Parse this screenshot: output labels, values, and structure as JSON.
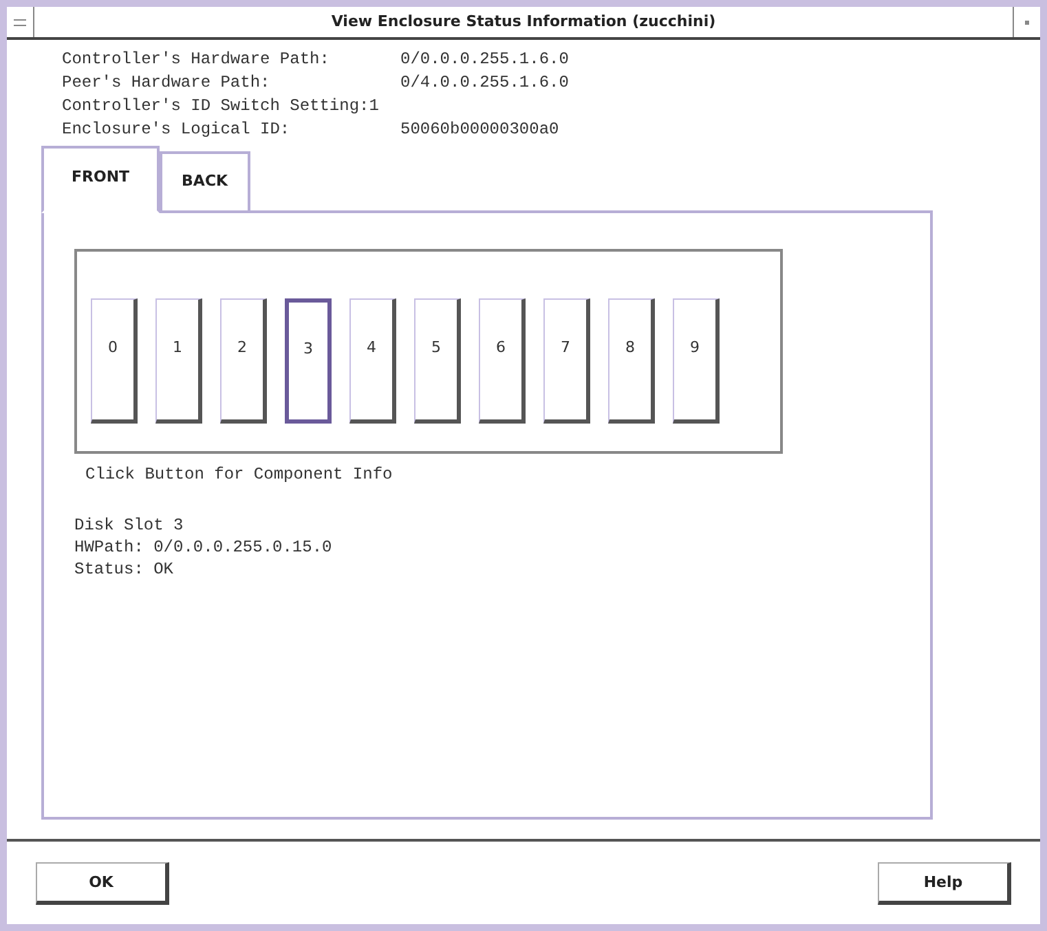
{
  "window": {
    "title": "View Enclosure Status Information (zucchini)"
  },
  "info_lines": [
    {
      "label": "Controller's Hardware Path:",
      "value": "0/0.0.0.255.1.6.0"
    },
    {
      "label": "Peer's Hardware Path:",
      "value": "0/4.0.0.255.1.6.0"
    },
    {
      "label": "Controller's ID Switch Setting:",
      "value": "1"
    },
    {
      "label": "Enclosure's Logical ID:",
      "value": "50060b00000300a0"
    }
  ],
  "tabs": [
    {
      "label": "FRONT",
      "selected": true
    },
    {
      "label": "BACK",
      "selected": false
    }
  ],
  "slots": [
    {
      "label": "0",
      "selected": false
    },
    {
      "label": "1",
      "selected": false
    },
    {
      "label": "2",
      "selected": false
    },
    {
      "label": "3",
      "selected": true
    },
    {
      "label": "4",
      "selected": false
    },
    {
      "label": "5",
      "selected": false
    },
    {
      "label": "6",
      "selected": false
    },
    {
      "label": "7",
      "selected": false
    },
    {
      "label": "8",
      "selected": false
    },
    {
      "label": "9",
      "selected": false
    }
  ],
  "hint": "Click Button for Component Info",
  "details": [
    "Disk Slot 3",
    "HWPath: 0/0.0.0.255.0.15.0",
    "Status: OK"
  ],
  "buttons": [
    "OK",
    "Help"
  ]
}
